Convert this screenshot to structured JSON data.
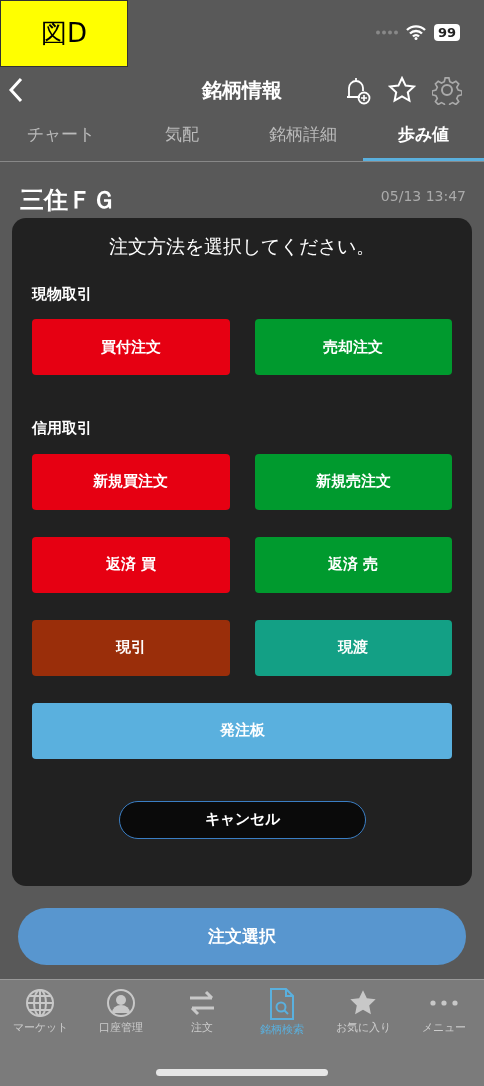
{
  "figure_label": "図D",
  "status_bar": {
    "battery": "99"
  },
  "header": {
    "title": "銘柄情報"
  },
  "tabs": [
    {
      "label": "チャート",
      "selected": false
    },
    {
      "label": "気配",
      "selected": false
    },
    {
      "label": "銘柄詳細",
      "selected": false
    },
    {
      "label": "歩み値",
      "selected": true
    }
  ],
  "stock": {
    "name": "三住ＦＧ",
    "datetime": "05/13 13:47"
  },
  "dialog": {
    "title": "注文方法を選択してください。",
    "sections": [
      {
        "heading": "現物取引",
        "buttons": [
          {
            "label": "買付注文",
            "kind": "buy"
          },
          {
            "label": "売却注文",
            "kind": "sell"
          }
        ]
      },
      {
        "heading": "信用取引",
        "buttons": [
          {
            "label": "新規買注文",
            "kind": "buy"
          },
          {
            "label": "新規売注文",
            "kind": "sell"
          },
          {
            "label": "返済 買",
            "kind": "buy"
          },
          {
            "label": "返済 売",
            "kind": "sell"
          },
          {
            "label": "現引",
            "kind": "delivery-take"
          },
          {
            "label": "現渡",
            "kind": "delivery-give"
          },
          {
            "label": "発注板",
            "kind": "board"
          }
        ]
      }
    ],
    "cancel": "キャンセル"
  },
  "action_button": "注文選択",
  "bottom_nav": [
    {
      "label": "マーケット",
      "kind": "globe",
      "selected": false
    },
    {
      "label": "口座管理",
      "kind": "person",
      "selected": false
    },
    {
      "label": "注文",
      "kind": "arrows",
      "selected": false
    },
    {
      "label": "銘柄検索",
      "kind": "doc-search",
      "selected": true
    },
    {
      "label": "お気に入り",
      "kind": "star",
      "selected": false
    },
    {
      "label": "メニュー",
      "kind": "dots",
      "selected": false
    }
  ]
}
